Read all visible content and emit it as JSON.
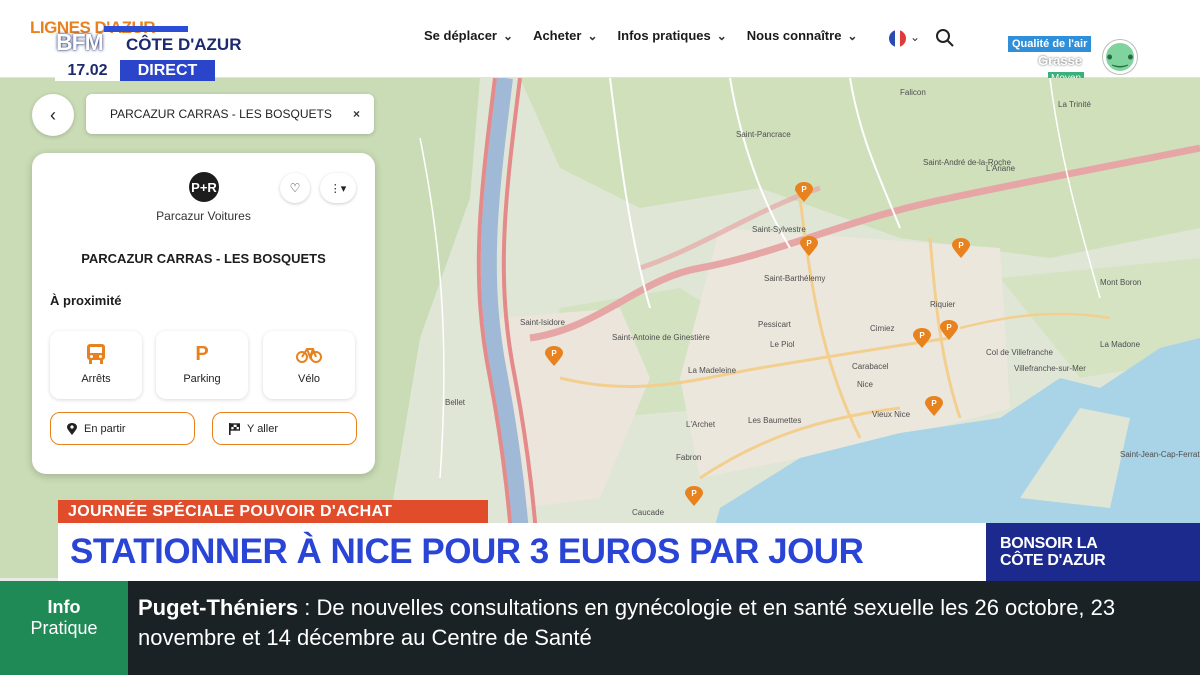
{
  "site": {
    "logo_text": "LIGNES D'AZUR",
    "nav": [
      {
        "label": "Se déplacer"
      },
      {
        "label": "Acheter"
      },
      {
        "label": "Infos pratiques"
      },
      {
        "label": "Nous connaître"
      }
    ],
    "air_quality": {
      "title": "Qualité de l'air",
      "city": "Grasse",
      "level": "Moyen"
    }
  },
  "search": {
    "value": "PARCAZUR CARRAS - LES BOSQUETS",
    "clear": "×"
  },
  "panel": {
    "logo_text": "P+R",
    "operator": "Parcazur Voitures",
    "station_name": "PARCAZUR CARRAS - LES BOSQUETS",
    "nearby_title": "À proximité",
    "tiles": [
      {
        "icon": "bus-icon",
        "label": "Arrêts"
      },
      {
        "icon": "parking-icon",
        "label": "Parking"
      },
      {
        "icon": "bike-icon",
        "label": "Vélo"
      }
    ],
    "actions": [
      {
        "icon": "pin-icon",
        "label": "En partir"
      },
      {
        "icon": "flag-icon",
        "label": "Y aller"
      }
    ]
  },
  "map_labels": [
    "Saint-Pancrace",
    "Saint-André de-la-Roche",
    "Falicon",
    "Saint-Sylvestre",
    "Saint-Barthélemy",
    "Pessicart",
    "Le Piol",
    "Cimiez",
    "Riquier",
    "La Trinité",
    "L'Ariane",
    "Nice",
    "Vieux Nice",
    "Carabacel",
    "Les Baumettes",
    "Fabron",
    "Caucade",
    "Saint-Isidore",
    "Saint-Antoine de Ginestière",
    "La Madeleine",
    "Col de Villefranche",
    "La Madone",
    "Villefranche-sur-Mer",
    "Saint-Jean-Cap-Ferrat",
    "Mont Boron",
    "L'Archet",
    "Bellet"
  ],
  "broadcast": {
    "channel": "BFM",
    "region": "CÔTE D'AZUR",
    "time": "17.02",
    "live": "DIRECT",
    "tag": "JOURNÉE SPÉCIALE POUVOIR D'ACHAT",
    "headline": "STATIONNER À NICE POUR 3 EUROS PAR JOUR",
    "show": [
      "BONSOIR LA",
      "CÔTE D'AZUR"
    ],
    "ticker_label": [
      "Info",
      "Pratique"
    ],
    "ticker_place": "Puget-Théniers",
    "ticker_text": ": De nouvelles consultations en gynécologie et en santé sexuelle les 26 octobre, 23 novembre et 14 décembre au Centre de Santé"
  },
  "colors": {
    "accent": "#e8821e",
    "bfm_blue": "#2a45d6",
    "tag_red": "#e14c2a",
    "ticker_green": "#1f8a55"
  }
}
